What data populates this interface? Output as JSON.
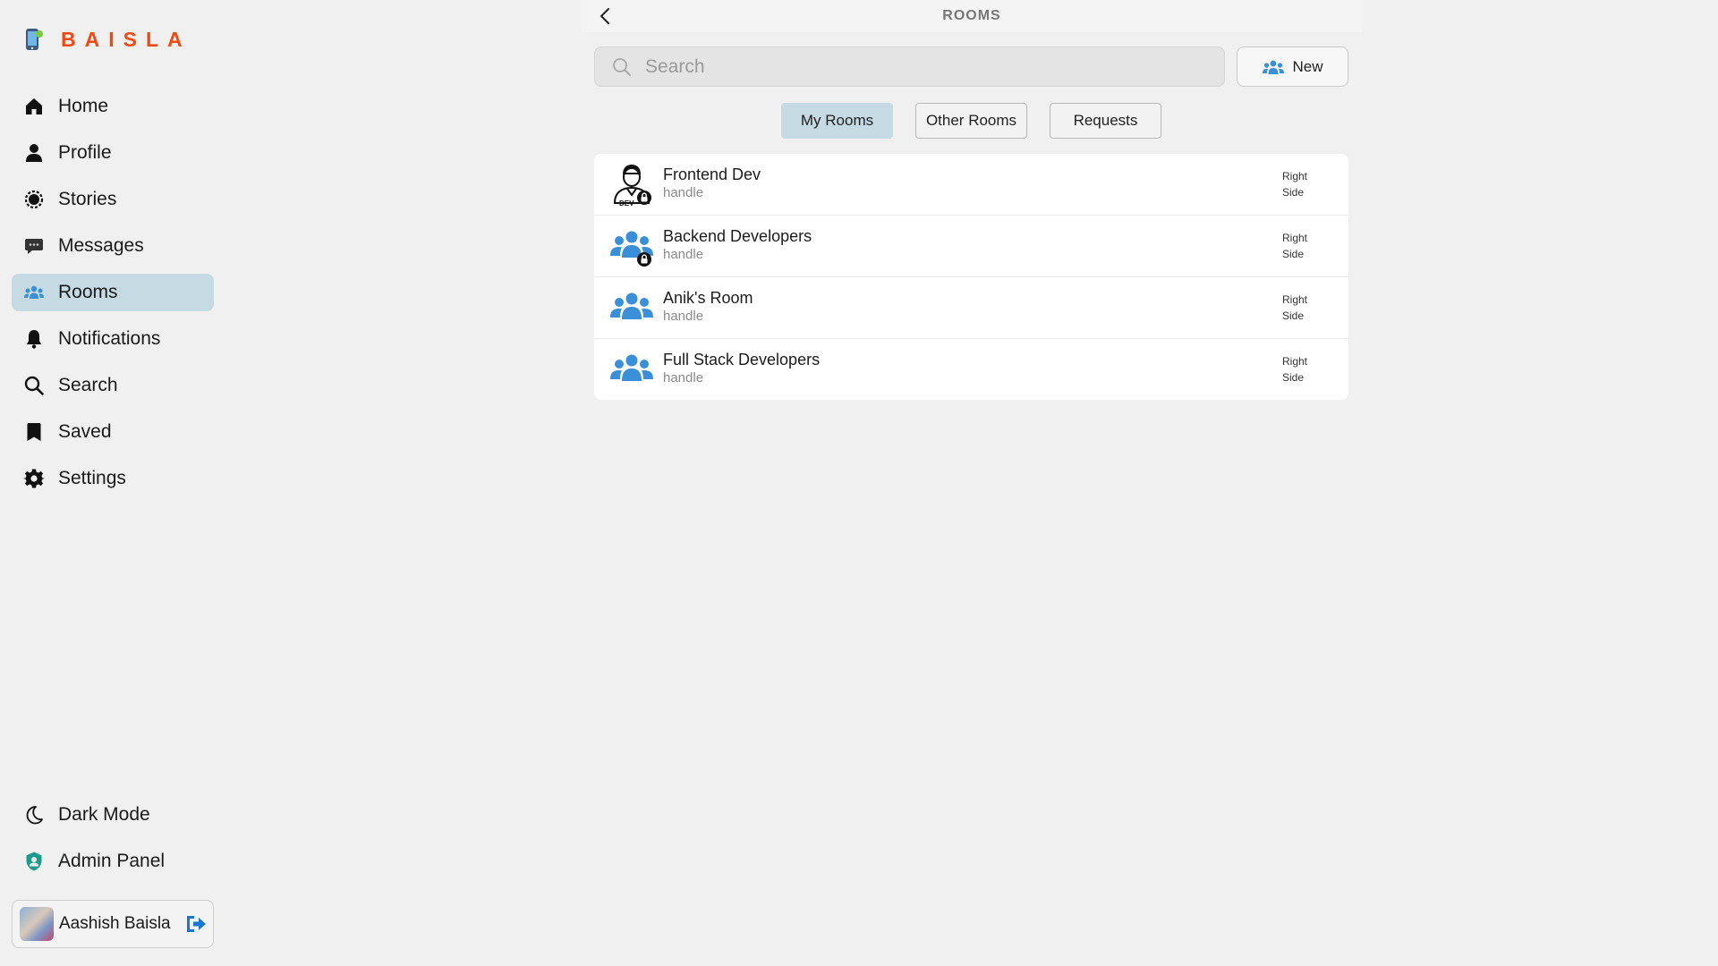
{
  "brand": {
    "name": "BAISLA",
    "color": "#f04a14"
  },
  "sidebar": {
    "items": [
      {
        "label": "Home",
        "icon": "home-icon",
        "active": false
      },
      {
        "label": "Profile",
        "icon": "user-icon",
        "active": false
      },
      {
        "label": "Stories",
        "icon": "stories-icon",
        "active": false
      },
      {
        "label": "Messages",
        "icon": "messages-icon",
        "active": false
      },
      {
        "label": "Rooms",
        "icon": "rooms-icon",
        "active": true
      },
      {
        "label": "Notifications",
        "icon": "bell-icon",
        "active": false
      },
      {
        "label": "Search",
        "icon": "search-icon",
        "active": false
      },
      {
        "label": "Saved",
        "icon": "bookmark-icon",
        "active": false
      },
      {
        "label": "Settings",
        "icon": "gear-icon",
        "active": false
      }
    ],
    "bottom_items": [
      {
        "label": "Dark Mode",
        "icon": "moon-icon"
      },
      {
        "label": "Admin Panel",
        "icon": "admin-icon"
      }
    ],
    "user": {
      "name": "Aashish Baisla"
    }
  },
  "header": {
    "title": "ROOMS"
  },
  "search": {
    "placeholder": "Search",
    "value": ""
  },
  "new_button": {
    "label": "New"
  },
  "tabs": [
    {
      "label": "My Rooms",
      "active": true
    },
    {
      "label": "Other Rooms",
      "active": false
    },
    {
      "label": "Requests",
      "active": false
    }
  ],
  "rooms": [
    {
      "name": "Frontend Dev",
      "handle": "handle",
      "right_line1": "Right",
      "right_line2": "Side",
      "avatar": "dev-person-icon",
      "locked": true
    },
    {
      "name": "Backend Developers",
      "handle": "handle",
      "right_line1": "Right",
      "right_line2": "Side",
      "avatar": "group-icon",
      "locked": true
    },
    {
      "name": "Anik's Room",
      "handle": "handle",
      "right_line1": "Right",
      "right_line2": "Side",
      "avatar": "group-icon",
      "locked": false
    },
    {
      "name": "Full Stack Developers",
      "handle": "handle",
      "right_line1": "Right",
      "right_line2": "Side",
      "avatar": "group-icon",
      "locked": false
    }
  ],
  "colors": {
    "accent": "#c5dae3",
    "group_icon": "#3a8fd8",
    "admin_icon": "#1a9c8c",
    "logout_icon": "#1976d2"
  }
}
